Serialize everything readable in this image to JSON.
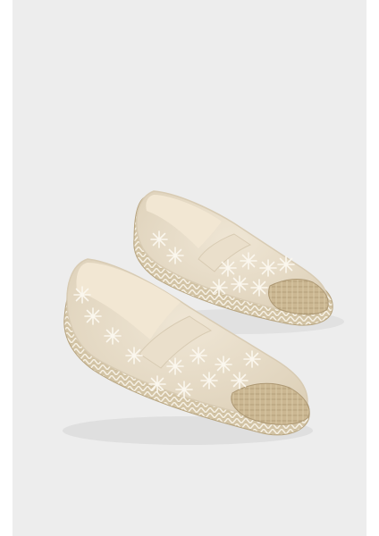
{
  "image": {
    "subject": "espadrille-pair",
    "colors": {
      "page": "#ffffff",
      "backdrop": "#ededed",
      "mesh": "#e9dfcd",
      "trim": "#eadfcb",
      "jute": "#cbb792",
      "jute_dark": "#ad9873",
      "insole": "#f2e7d3",
      "embroidery": "#fbf7ee",
      "sole_edge": "#d8cbb3"
    }
  }
}
